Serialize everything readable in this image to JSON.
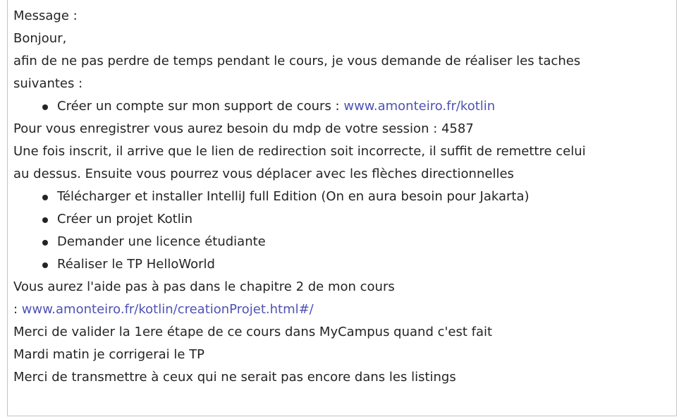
{
  "message": {
    "label": "Message :",
    "greeting": "Bonjour,",
    "intro_line1": "afin de ne pas perdre de temps pendant le cours, je vous demande de réaliser les taches",
    "intro_line2": "suivantes :",
    "first_task": {
      "text": "Créer un compte sur mon support de cours : ",
      "link": "www.amonteiro.fr/kotlin"
    },
    "session_line": "Pour vous enregistrer vous aurez besoin du mdp de votre session : 4587",
    "redirect_line1": "Une fois inscrit, il arrive que le lien de redirection soit incorrecte, il suffit de remettre celui",
    "redirect_line2": "au dessus. Ensuite vous pourrez vous déplacer avec les flèches directionnelles",
    "tasks": [
      "Télécharger et installer IntelliJ full Edition (On en aura besoin pour Jakarta)",
      "Créer un projet Kotlin",
      "Demander une licence étudiante",
      "Réaliser le TP HelloWorld"
    ],
    "help_line": "Vous aurez l'aide pas à pas dans le chapitre 2 de mon cours",
    "help_link_prefix": ": ",
    "help_link": "www.amonteiro.fr/kotlin/creationProjet.html#/",
    "validate_line": "Merci de valider la 1ere étape de ce cours dans MyCampus quand c'est fait",
    "tuesday_line": "Mardi matin je corrigerai le TP",
    "forward_line": "Merci de transmettre à ceux qui ne serait pas encore dans les listings"
  },
  "colors": {
    "text": "#242424",
    "link": "#4f52b2",
    "border": "#c4c4c4"
  }
}
